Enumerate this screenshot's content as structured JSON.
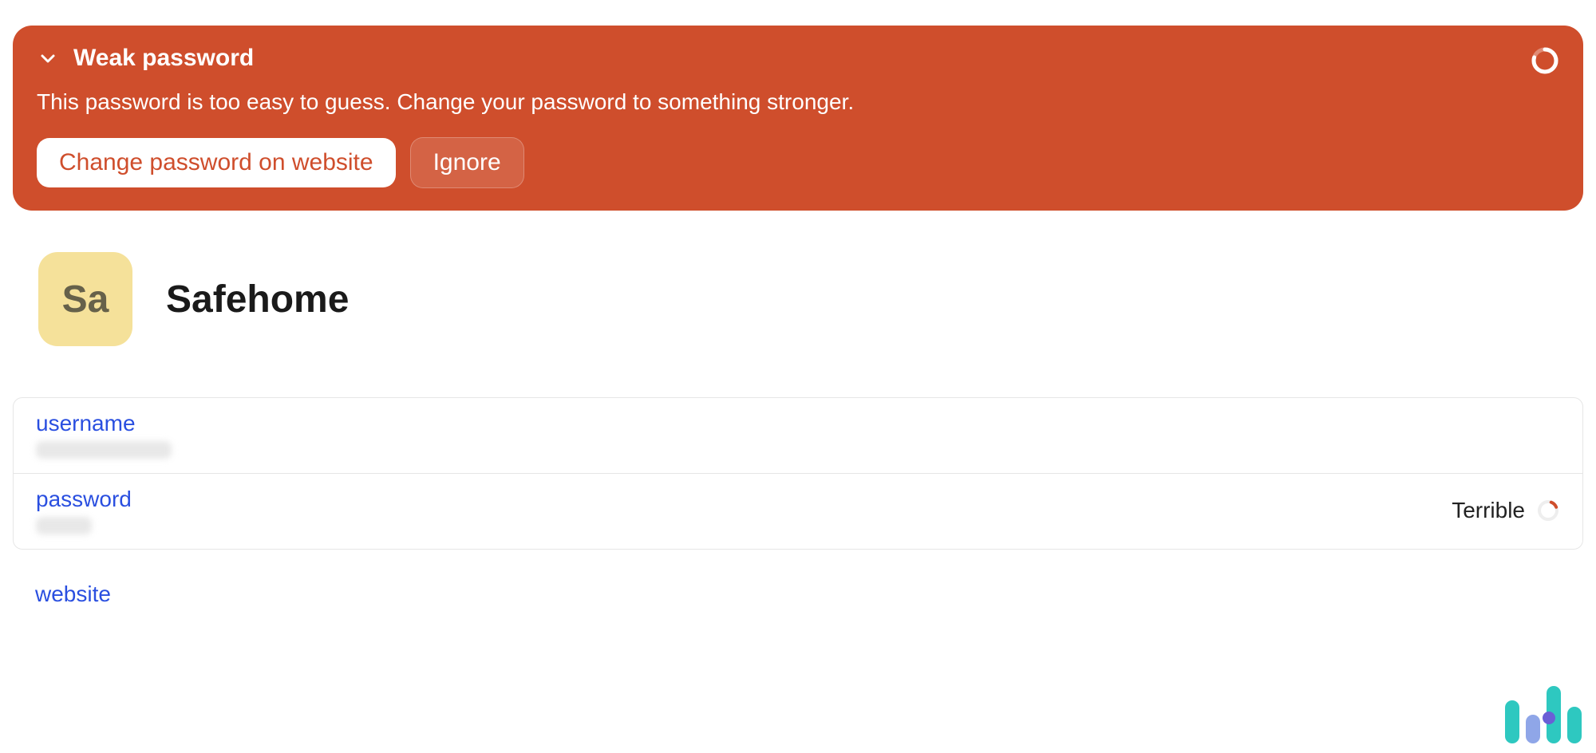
{
  "alert": {
    "title": "Weak password",
    "body": "This password is too easy to guess. Change your password to something stronger.",
    "primary_button": "Change password on website",
    "secondary_button": "Ignore"
  },
  "item": {
    "avatar_text": "Sa",
    "title": "Safehome"
  },
  "fields": {
    "username_label": "username",
    "password_label": "password",
    "password_strength": "Terrible",
    "website_label": "website"
  }
}
